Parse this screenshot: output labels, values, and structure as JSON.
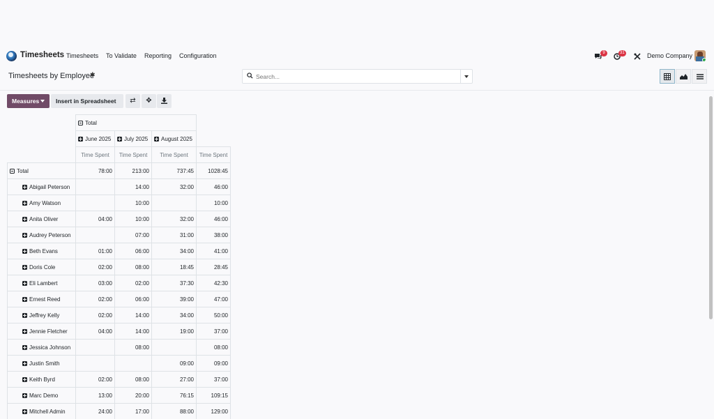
{
  "navbar": {
    "app_name": "Timesheets",
    "menu": [
      "Timesheets",
      "To Validate",
      "Reporting",
      "Configuration"
    ],
    "messages_count": "9",
    "activities_count": "31",
    "company": "Demo Company"
  },
  "subheader": {
    "title": "Timesheets by Employee",
    "search_placeholder": "Search..."
  },
  "toolbar": {
    "measures_label": "Measures",
    "insert_label": "Insert in Spreadsheet"
  },
  "pivot": {
    "col_total_label": "Total",
    "months": [
      "June 2025",
      "July 2025",
      "August 2025"
    ],
    "measure_label": "Time Spent",
    "row_total_label": "Total",
    "total_row": [
      "78:00",
      "213:00",
      "737:45",
      "1028:45"
    ],
    "rows": [
      {
        "name": "Abigail Peterson",
        "values": [
          "",
          "14:00",
          "32:00",
          "46:00"
        ]
      },
      {
        "name": "Amy Watson",
        "values": [
          "",
          "10:00",
          "",
          "10:00"
        ]
      },
      {
        "name": "Anita Oliver",
        "values": [
          "04:00",
          "10:00",
          "32:00",
          "46:00"
        ]
      },
      {
        "name": "Audrey Peterson",
        "values": [
          "",
          "07:00",
          "31:00",
          "38:00"
        ]
      },
      {
        "name": "Beth Evans",
        "values": [
          "01:00",
          "06:00",
          "34:00",
          "41:00"
        ]
      },
      {
        "name": "Doris Cole",
        "values": [
          "02:00",
          "08:00",
          "18:45",
          "28:45"
        ]
      },
      {
        "name": "Eli Lambert",
        "values": [
          "03:00",
          "02:00",
          "37:30",
          "42:30"
        ]
      },
      {
        "name": "Ernest Reed",
        "values": [
          "02:00",
          "06:00",
          "39:00",
          "47:00"
        ]
      },
      {
        "name": "Jeffrey Kelly",
        "values": [
          "02:00",
          "14:00",
          "34:00",
          "50:00"
        ]
      },
      {
        "name": "Jennie Fletcher",
        "values": [
          "04:00",
          "14:00",
          "19:00",
          "37:00"
        ]
      },
      {
        "name": "Jessica Johnson",
        "values": [
          "",
          "08:00",
          "",
          "08:00"
        ]
      },
      {
        "name": "Justin Smith",
        "values": [
          "",
          "",
          "09:00",
          "09:00"
        ]
      },
      {
        "name": "Keith Byrd",
        "values": [
          "02:00",
          "08:00",
          "27:00",
          "37:00"
        ]
      },
      {
        "name": "Marc Demo",
        "values": [
          "13:00",
          "20:00",
          "76:15",
          "109:15"
        ]
      },
      {
        "name": "Mitchell Admin",
        "values": [
          "24:00",
          "17:00",
          "88:00",
          "129:00"
        ]
      }
    ]
  }
}
